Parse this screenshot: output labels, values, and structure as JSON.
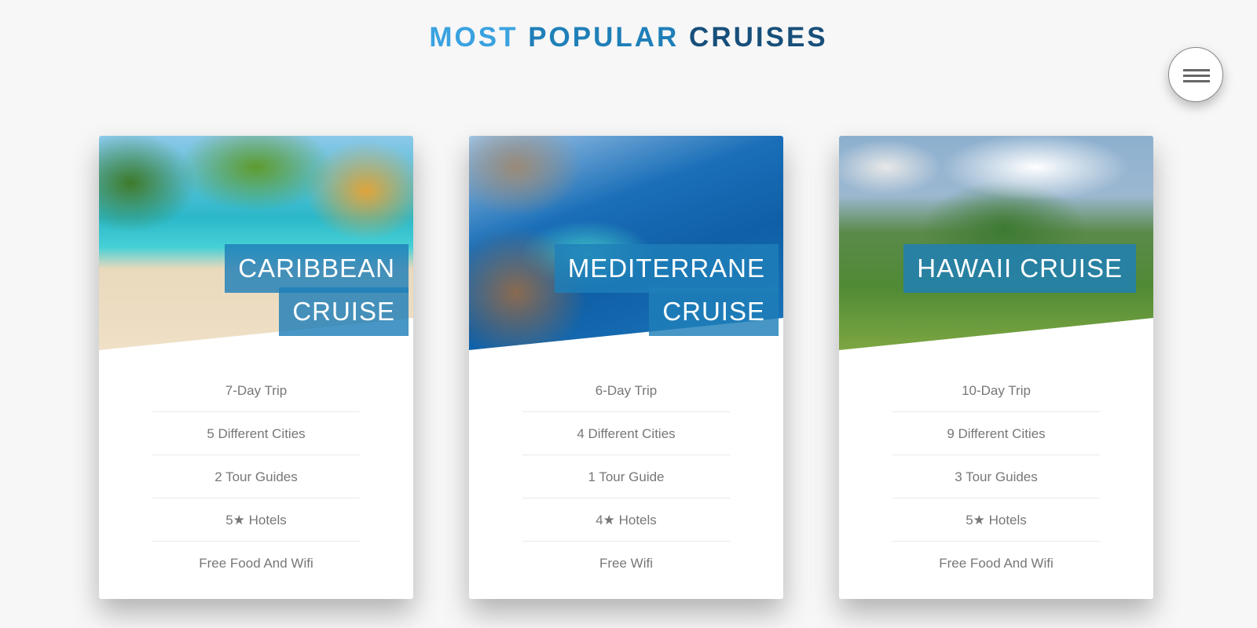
{
  "heading": {
    "part1": "MOST ",
    "part2": "POPULAR ",
    "part3": "CRUISES"
  },
  "menu": {
    "icon": "hamburger-menu-icon"
  },
  "cards": [
    {
      "title_line1": "CARIBBEAN",
      "title_line2": "CRUISE",
      "image": "tropical-beach-palms-image",
      "features": [
        "7-Day Trip",
        "5 Different Cities",
        "2 Tour Guides",
        "5★ Hotels",
        "Free Food And Wifi"
      ]
    },
    {
      "title_line1": "MEDITERRANE",
      "title_line2": "CRUISE",
      "image": "coastal-town-bay-image",
      "features": [
        "6-Day Trip",
        "4 Different Cities",
        "1 Tour Guide",
        "4★ Hotels",
        "Free Wifi"
      ]
    },
    {
      "title_line1": "HAWAII CRUISE",
      "image": "green-mountains-clouds-image",
      "features": [
        "10-Day Trip",
        "9 Different Cities",
        "3 Tour Guides",
        "5★ Hotels",
        "Free Food And Wifi"
      ]
    }
  ],
  "colors": {
    "background": "#f7f7f7",
    "heading_light_blue": "#3aa2e0",
    "heading_mid_blue": "#1f7fb8",
    "heading_dark_blue": "#174f7a",
    "label_box": "#1f7fb8",
    "feature_text": "#777777"
  }
}
